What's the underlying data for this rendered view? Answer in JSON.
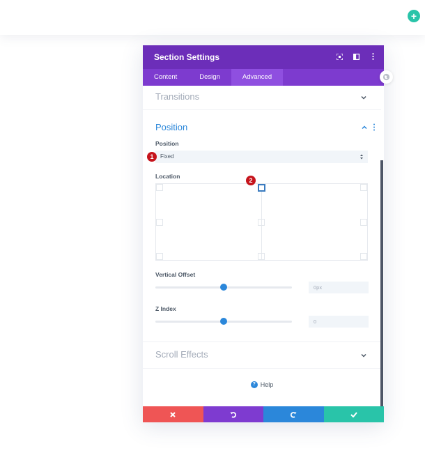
{
  "topbar": {
    "add_icon": "plus-icon",
    "add_color": "#29c4a9"
  },
  "modal": {
    "title": "Section Settings",
    "header_icons": [
      "expand-icon",
      "split-view-icon",
      "more-vertical-icon"
    ],
    "tabs": [
      {
        "label": "Content",
        "active": false
      },
      {
        "label": "Design",
        "active": false
      },
      {
        "label": "Advanced",
        "active": true
      }
    ],
    "colors": {
      "header": "#6c2eb9",
      "tabs": "#7d3bcf",
      "active_tab": "#8f4fe0",
      "accent": "#2b87da"
    }
  },
  "sections": {
    "transitions": {
      "title": "Transitions",
      "expanded": false
    },
    "position": {
      "title": "Position",
      "expanded": true,
      "position_field": {
        "label": "Position",
        "value": "Fixed",
        "badge": "1"
      },
      "location_field": {
        "label": "Location",
        "selected_anchor": "top-center",
        "anchors": [
          "top-left",
          "top-center",
          "top-right",
          "center-left",
          "center",
          "center-right",
          "bottom-left",
          "bottom-center",
          "bottom-right"
        ],
        "badge": "2"
      },
      "vertical_offset": {
        "label": "Vertical Offset",
        "value": "0px",
        "slider_fraction": 0.5
      },
      "z_index": {
        "label": "Z Index",
        "value": "0",
        "slider_fraction": 0.5
      }
    },
    "scroll_effects": {
      "title": "Scroll Effects",
      "expanded": false
    }
  },
  "help": {
    "label": "Help",
    "icon": "question-icon"
  },
  "footer": {
    "buttons": [
      {
        "name": "cancel",
        "icon": "close-icon",
        "color": "#ef5555"
      },
      {
        "name": "undo",
        "icon": "undo-icon",
        "color": "#7e3bd0"
      },
      {
        "name": "redo",
        "icon": "redo-icon",
        "color": "#2b87da"
      },
      {
        "name": "save",
        "icon": "check-icon",
        "color": "#29c4a9"
      }
    ]
  }
}
